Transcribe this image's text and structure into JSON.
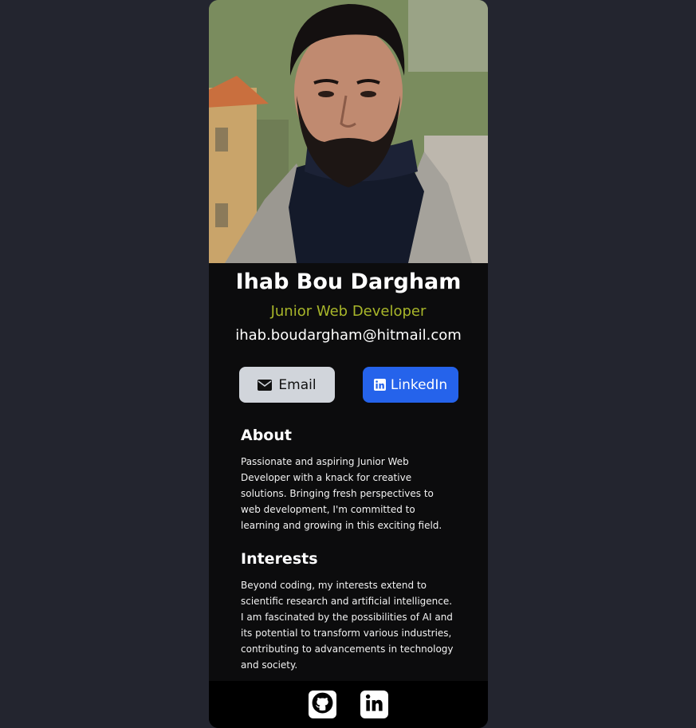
{
  "profile": {
    "name": "Ihab Bou Dargham",
    "role": "Junior Web Developer",
    "email": "ihab.boudargham@hitmail.com"
  },
  "buttons": {
    "email_label": "Email",
    "linkedin_label": "LinkedIn"
  },
  "about": {
    "heading": "About",
    "text": "Passionate and aspiring Junior Web Developer with a knack for creative solutions. Bringing fresh perspectives to web development, I'm committed to learning and growing in this exciting field."
  },
  "interests": {
    "heading": "Interests",
    "text": "Beyond coding, my interests extend to scientific research and artificial intelligence. I am fascinated by the possibilities of AI and its potential to transform various industries, contributing to advancements in technology and society."
  },
  "footer": {
    "icons": [
      "github-icon",
      "linkedin-icon"
    ]
  },
  "colors": {
    "page_bg": "#23252f",
    "card_bg": "#0c0c0d",
    "role_accent": "#a8b62a",
    "email_button_bg": "#d1d5db",
    "linkedin_button_bg": "#2563eb",
    "footer_bg": "#000000"
  }
}
